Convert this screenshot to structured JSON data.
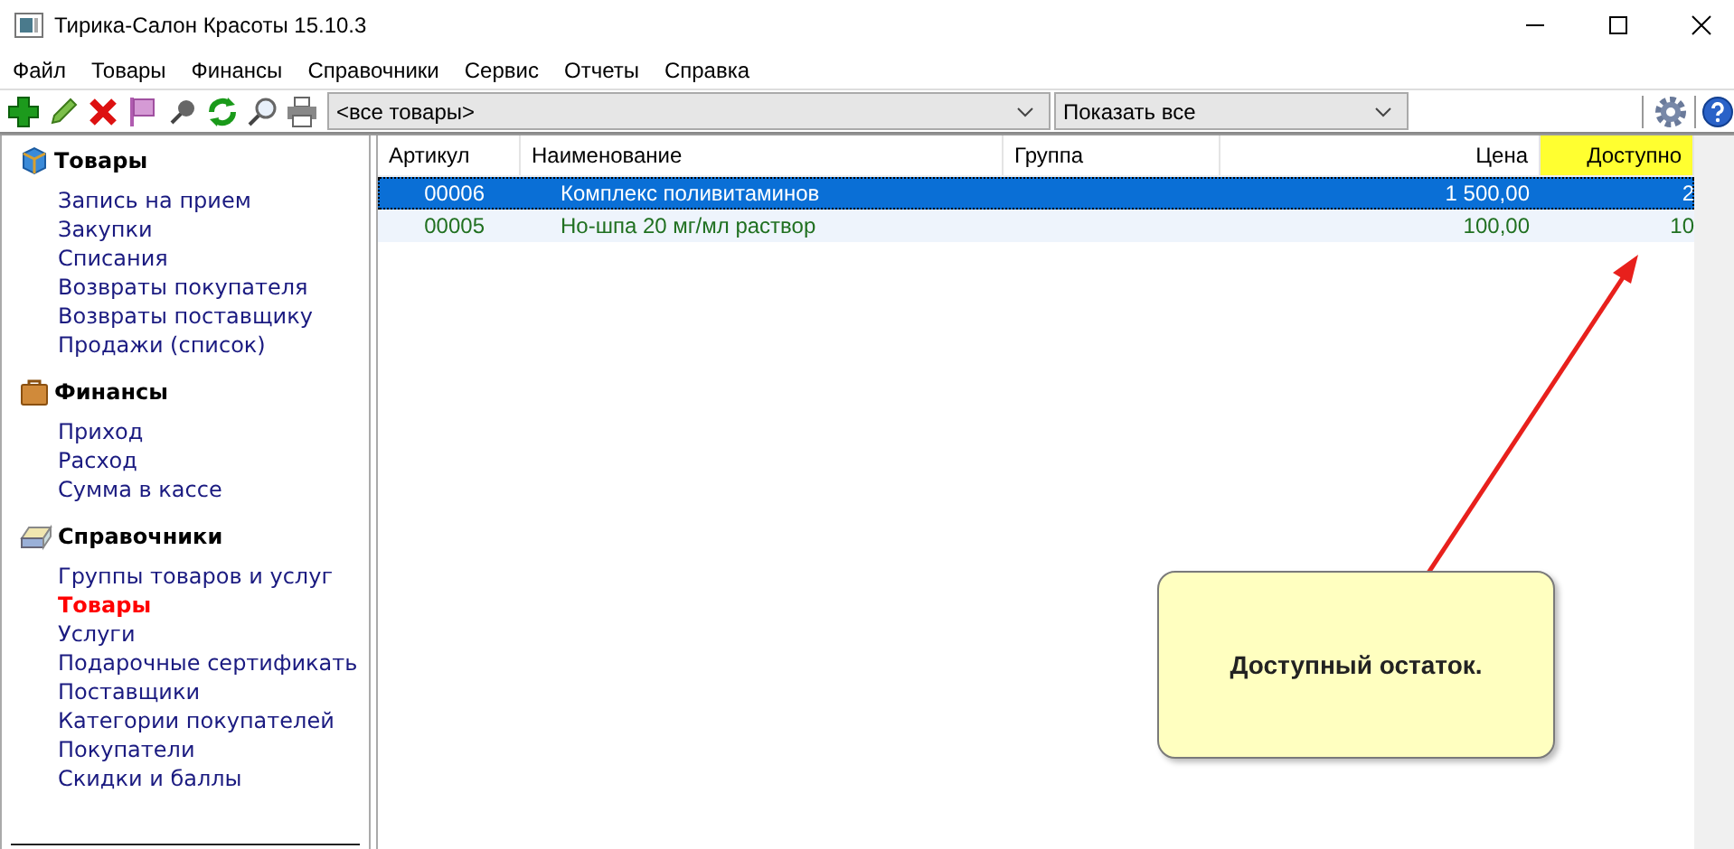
{
  "window": {
    "title": "Тирика-Салон Красоты 15.10.3"
  },
  "menu": [
    "Файл",
    "Товары",
    "Финансы",
    "Справочники",
    "Сервис",
    "Отчеты",
    "Справка"
  ],
  "toolbar": {
    "filter": {
      "value": "<все товары>"
    },
    "show": {
      "value": "Показать все"
    }
  },
  "sidebar": {
    "groups": [
      {
        "title": "Товары",
        "items": [
          {
            "label": "Запись на прием",
            "selected": false
          },
          {
            "label": "Закупки",
            "selected": false
          },
          {
            "label": "Списания",
            "selected": false
          },
          {
            "label": "Возвраты покупателя",
            "selected": false
          },
          {
            "label": "Возвраты поставщику",
            "selected": false
          },
          {
            "label": "Продажи (список)",
            "selected": false
          }
        ]
      },
      {
        "title": "Финансы",
        "items": [
          {
            "label": "Приход",
            "selected": false
          },
          {
            "label": "Расход",
            "selected": false
          },
          {
            "label": "Сумма в кассе",
            "selected": false
          }
        ]
      },
      {
        "title": "Справочники",
        "items": [
          {
            "label": "Группы товаров и услуг",
            "selected": false
          },
          {
            "label": "Товары",
            "selected": true
          },
          {
            "label": "Услуги",
            "selected": false
          },
          {
            "label": "Подарочные сертификать",
            "selected": false
          },
          {
            "label": "Поставщики",
            "selected": false
          },
          {
            "label": "Категории покупателей",
            "selected": false
          },
          {
            "label": "Покупатели",
            "selected": false
          },
          {
            "label": "Скидки и баллы",
            "selected": false
          }
        ]
      }
    ]
  },
  "table": {
    "columns": [
      {
        "label": "Артикул",
        "kind": "article",
        "highlighted": false
      },
      {
        "label": "Наименование",
        "kind": "name",
        "highlighted": false
      },
      {
        "label": "Группа",
        "kind": "group",
        "highlighted": false
      },
      {
        "label": "Цена",
        "kind": "price",
        "highlighted": false
      },
      {
        "label": "Доступно",
        "kind": "available",
        "highlighted": true
      }
    ],
    "rows": [
      {
        "article": "00006",
        "name": "Комплекс поливитаминов",
        "price": "1 500,00",
        "available": "2",
        "selected": true
      },
      {
        "article": "00005",
        "name": "Но-шпа 20 мг/мл раствор",
        "price": "100,00",
        "available": "10",
        "selected": false
      }
    ]
  },
  "callout": {
    "text": "Доступный остаток."
  }
}
